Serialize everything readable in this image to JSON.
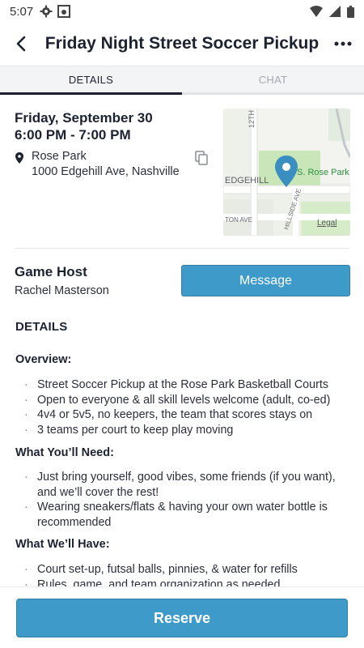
{
  "status_bar": {
    "time": "5:07",
    "icons": [
      "settings-icon",
      "photo-icon",
      "wifi-icon",
      "signal-icon",
      "battery-icon"
    ]
  },
  "app_bar": {
    "title": "Friday Night Street Soccer Pickup",
    "back_icon": "back-arrow-icon",
    "more_icon": "more-dots-icon"
  },
  "tabs": [
    {
      "label": "DETAILS",
      "active": true
    },
    {
      "label": "CHAT",
      "active": false
    }
  ],
  "event": {
    "date": "Friday, September 30",
    "time": "6:00 PM - 7:00 PM",
    "venue": "Rose Park",
    "address": "1000 Edgehill Ave,  Nashville",
    "map": {
      "street_12th": "12TH",
      "street_edgehill": "EDGEHILL",
      "poi": "S. Rose Park",
      "street_hillside": "HILLSIDE AVE",
      "street_ton": "TON AVE",
      "legal": "Legal"
    }
  },
  "host": {
    "label": "Game Host",
    "name": "Rachel Masterson",
    "message_label": "Message"
  },
  "details": {
    "heading": "DETAILS",
    "sections": [
      {
        "title": "Overview:",
        "items": [
          "Street Soccer Pickup at the Rose Park Basketball Courts",
          "Open to everyone & all skill levels welcome (adult, co-ed)",
          "4v4 or 5v5, no keepers, the team that scores stays on",
          "3 teams per court to keep play moving"
        ]
      },
      {
        "title": "What You’ll Need:",
        "items": [
          "Just bring yourself, good vibes, some friends (if you want), and we’ll cover the rest!",
          "Wearing sneakers/flats & having your own water bottle is recommended"
        ]
      },
      {
        "title": "What We’ll Have:",
        "items": [
          "Court set-up, futsal balls, pinnies, & water for refills",
          "Rules, game, and team organization as needed"
        ]
      }
    ]
  },
  "reserve_label": "Reserve",
  "colors": {
    "accent": "#3e9ac9",
    "text": "#1c2230",
    "map_green": "#c9e6b8",
    "pin": "#3a8fc0"
  }
}
